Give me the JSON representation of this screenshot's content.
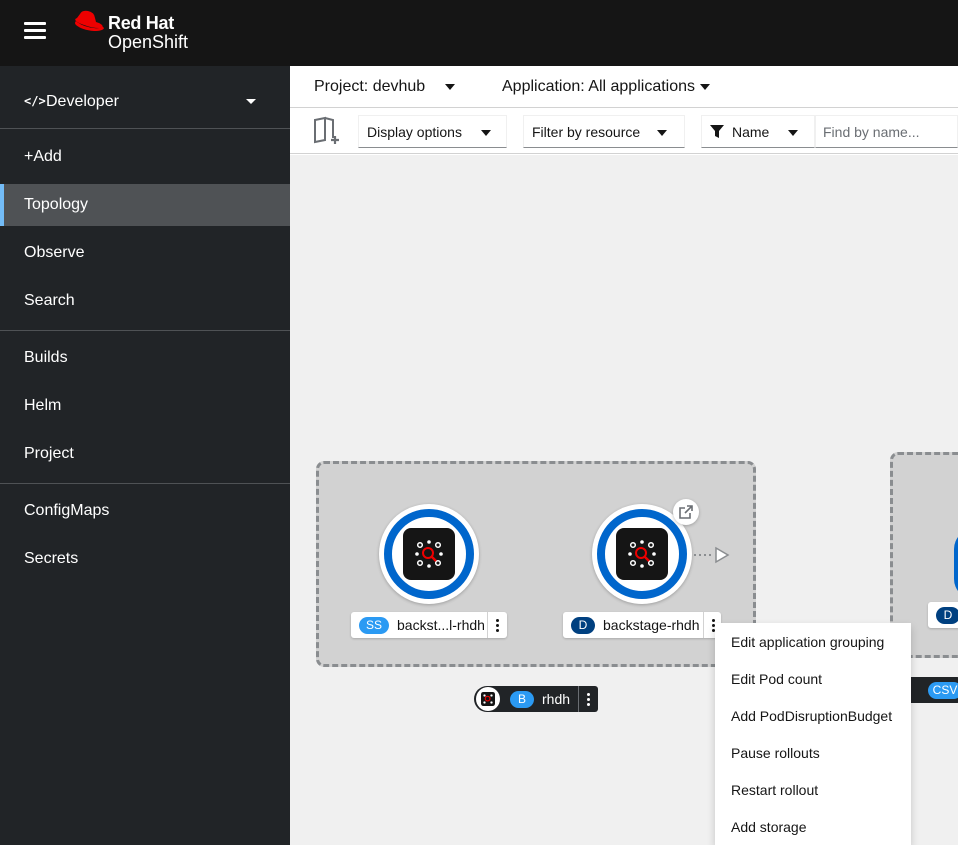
{
  "masthead": {
    "brand_line1": "Red Hat",
    "brand_line2": "OpenShift",
    "brand_color": "#ee0000"
  },
  "sidebar": {
    "perspective": "Developer",
    "items": [
      {
        "label": "+Add",
        "active": false
      },
      {
        "label": "Topology",
        "active": true
      },
      {
        "label": "Observe",
        "active": false
      },
      {
        "label": "Search",
        "active": false
      },
      {
        "label": "Builds",
        "active": false
      },
      {
        "label": "Helm",
        "active": false
      },
      {
        "label": "Project",
        "active": false
      },
      {
        "label": "ConfigMaps",
        "active": false
      },
      {
        "label": "Secrets",
        "active": false
      }
    ]
  },
  "project_bar": {
    "project": "Project: devhub",
    "application": "Application: All applications"
  },
  "toolbar": {
    "display_options": "Display options",
    "filter_by_resource": "Filter by resource",
    "filter_type": "Name",
    "find_placeholder": "Find by name..."
  },
  "topology": {
    "nodes": [
      {
        "badge": "SS",
        "name": "backst...l-rhdh"
      },
      {
        "badge": "D",
        "name": "backstage-rhdh"
      }
    ],
    "application_group": {
      "badge": "B",
      "name": "rhdh"
    },
    "partial_right": {
      "badge_d": "D",
      "badge_csv": "CSV"
    }
  },
  "context_menu": {
    "items": [
      "Edit application grouping",
      "Edit Pod count",
      "Add PodDisruptionBudget",
      "Pause rollouts",
      "Restart rollout",
      "Add storage"
    ]
  },
  "colors": {
    "accent_blue": "#0066cc",
    "active_indicator": "#73bcf7",
    "sidebar_bg": "#212427",
    "masthead_bg": "#151515"
  }
}
